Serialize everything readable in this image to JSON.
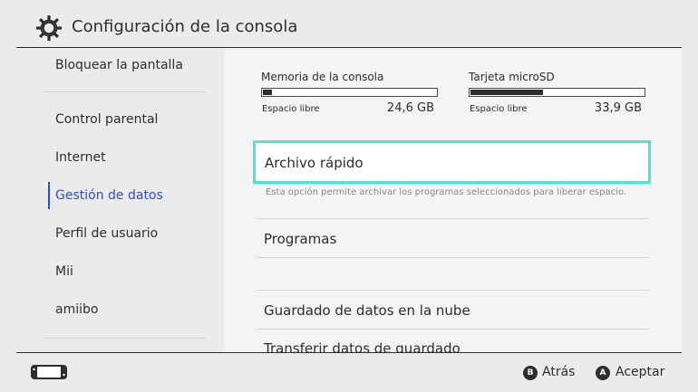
{
  "header": {
    "title": "Configuración de la consola",
    "icon": "gear-icon"
  },
  "sidebar": {
    "items": [
      {
        "label": "Bloquear la pantalla"
      },
      {
        "label": "Control parental"
      },
      {
        "label": "Internet"
      },
      {
        "label": "Gestión de datos",
        "active": true
      },
      {
        "label": "Perfil de usuario"
      },
      {
        "label": "Mii"
      },
      {
        "label": "amiibo"
      }
    ]
  },
  "storage": {
    "console": {
      "title": "Memoria de la consola",
      "free_label": "Espacio libre",
      "free_value": "24,6 GB",
      "used_fraction": 0.05
    },
    "sd": {
      "title": "Tarjeta microSD",
      "free_label": "Espacio libre",
      "free_value": "33,9 GB",
      "used_fraction": 0.42
    }
  },
  "options": [
    {
      "label": "Archivo rápido",
      "selected": true,
      "description": "Esta opción permite archivar los programas seleccionados para liberar espacio."
    },
    {
      "label": "Programas"
    },
    {
      "label": "Guardado de datos en la nube"
    },
    {
      "label": "Transferir datos de guardado"
    }
  ],
  "footer": {
    "back_key": "B",
    "back_label": "Atrás",
    "accept_key": "A",
    "accept_label": "Aceptar"
  },
  "colors": {
    "accent_blue": "#2b4fd0",
    "selection_cyan": "#4fe3d1"
  }
}
